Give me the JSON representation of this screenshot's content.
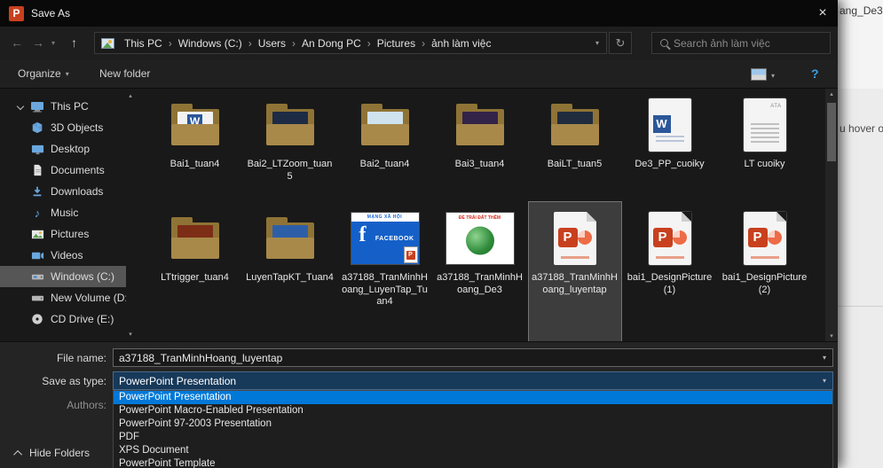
{
  "window": {
    "title": "Save As"
  },
  "background_window": {
    "title_fragment": "ang_De3",
    "text_fragment": "u hover ov"
  },
  "nav": {
    "breadcrumb": [
      "This PC",
      "Windows (C:)",
      "Users",
      "An Dong PC",
      "Pictures",
      "ảnh làm việc"
    ],
    "search_placeholder": "Search ảnh làm việc"
  },
  "toolbar": {
    "organize_label": "Organize",
    "new_folder_label": "New folder",
    "help_label": "?"
  },
  "sidebar": {
    "items": [
      {
        "label": "This PC"
      },
      {
        "label": "3D Objects"
      },
      {
        "label": "Desktop"
      },
      {
        "label": "Documents"
      },
      {
        "label": "Downloads"
      },
      {
        "label": "Music"
      },
      {
        "label": "Pictures"
      },
      {
        "label": "Videos"
      },
      {
        "label": "Windows (C:)",
        "selected": true
      },
      {
        "label": "New Volume (D:"
      },
      {
        "label": "CD Drive (E:)"
      }
    ]
  },
  "files": [
    {
      "name": "Bai1_tuan4",
      "type": "folder"
    },
    {
      "name": "Bai2_LTZoom_tuan5",
      "type": "folder"
    },
    {
      "name": "Bai2_tuan4",
      "type": "folder"
    },
    {
      "name": "Bai3_tuan4",
      "type": "folder"
    },
    {
      "name": "BaiLT_tuan5",
      "type": "folder"
    },
    {
      "name": "De3_PP_cuoiky",
      "type": "word-document"
    },
    {
      "name": "LT cuoiky",
      "type": "document",
      "icon_text": "ATA"
    },
    {
      "name": "LTtrigger_tuan4",
      "type": "folder"
    },
    {
      "name": "LuyenTapKT_Tuan4",
      "type": "folder"
    },
    {
      "name": "a37188_TranMinhHoang_LuyenTap_Tuan4",
      "type": "image",
      "thumb_banner": "MẠNG XÃ HỘI",
      "thumb_text": "FACEBOOK"
    },
    {
      "name": "a37188_TranMinhHoang_De3",
      "type": "image",
      "thumb_text": "ĐỂ TRÁI ĐẤT THÊM"
    },
    {
      "name": "a37188_TranMinhHoang_luyentap",
      "type": "powerpoint",
      "selected": true
    },
    {
      "name": "bai1_DesignPicture (1)",
      "type": "powerpoint"
    },
    {
      "name": "bai1_DesignPicture (2)",
      "type": "powerpoint"
    }
  ],
  "form": {
    "file_name_label": "File name:",
    "file_name_value": "a37188_TranMinhHoang_luyentap",
    "save_type_label": "Save as type:",
    "save_type_value": "PowerPoint Presentation",
    "authors_label": "Authors:",
    "hide_folders_label": "Hide Folders"
  },
  "save_type_dropdown": {
    "selected_index": 0,
    "options": [
      "PowerPoint Presentation",
      "PowerPoint Macro-Enabled Presentation",
      "PowerPoint 97-2003 Presentation",
      "PDF",
      "XPS Document",
      "PowerPoint Template"
    ]
  },
  "icons": {
    "powerpoint_letter": "P",
    "word_letter": "W",
    "facebook_letter": "f"
  },
  "colors": {
    "selection_blue": "#0078d7",
    "powerpoint_orange": "#c8401e",
    "folder_yellow": "#a8894a"
  }
}
